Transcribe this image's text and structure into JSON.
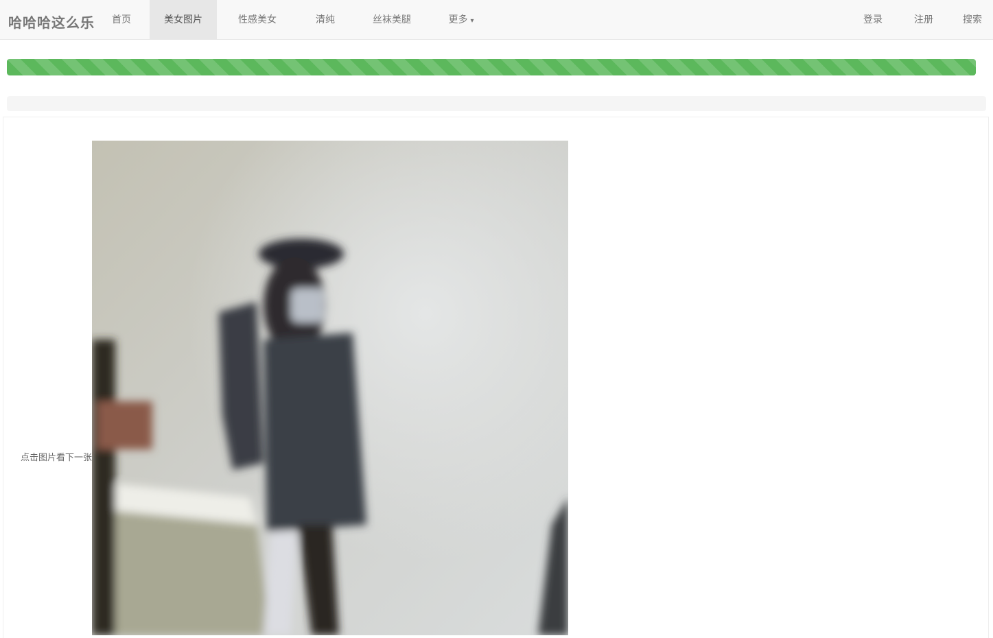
{
  "brand": "哈哈哈这么乐",
  "nav": {
    "items": [
      {
        "label": "首页"
      },
      {
        "label": "美女图片"
      },
      {
        "label": "性感美女"
      },
      {
        "label": "清纯"
      },
      {
        "label": "丝袜美腿"
      },
      {
        "label": "更多"
      }
    ],
    "right": [
      {
        "label": "登录"
      },
      {
        "label": "注册"
      },
      {
        "label": "搜索"
      }
    ]
  },
  "progress": {
    "value": 1.0,
    "color": "#5cb85c"
  },
  "content": {
    "side_label": "点击图片看下一张",
    "photo_icon": "photo-image"
  },
  "colors": {
    "navbar": "#f8f8f8",
    "active_tab": "#e7e7e7",
    "progress": "#5cb85c"
  }
}
